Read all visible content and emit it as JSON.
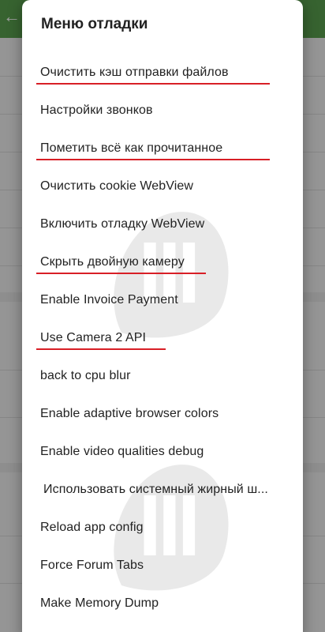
{
  "dialog": {
    "title": "Меню отладки",
    "items": [
      {
        "label": "Очистить кэш отправки файлов"
      },
      {
        "label": "Настройки звонков"
      },
      {
        "label": "Пометить всё как прочитанное"
      },
      {
        "label": "Очистить cookie WebView"
      },
      {
        "label": "Включить отладку WebView"
      },
      {
        "label": "Скрыть двойную камеру"
      },
      {
        "label": "Enable Invoice Payment"
      },
      {
        "label": "Use Camera 2 API"
      },
      {
        "label": "back to cpu blur"
      },
      {
        "label": "Enable adaptive browser colors"
      },
      {
        "label": "Enable video qualities debug"
      },
      {
        "label": "Использовать системный жирный ш..."
      },
      {
        "label": "Reload app config"
      },
      {
        "label": "Force Forum Tabs"
      },
      {
        "label": "Make Memory Dump"
      }
    ]
  },
  "colors": {
    "app_bar": "#5aa04e",
    "highlight_underline": "#d81f26"
  },
  "icons": {
    "back": "back-arrow-icon"
  }
}
